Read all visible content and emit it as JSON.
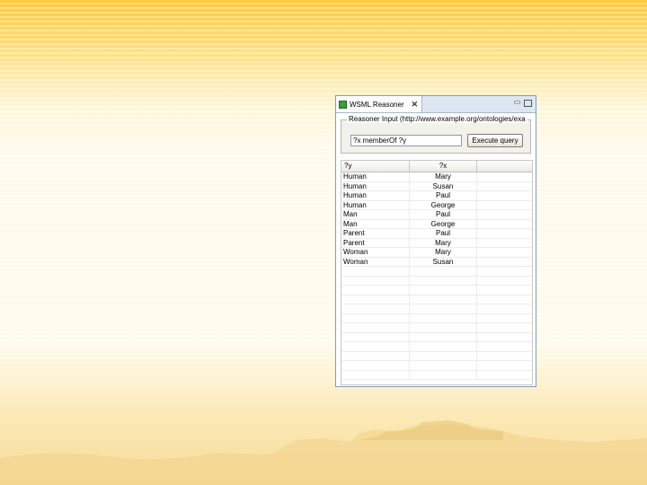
{
  "view": {
    "tab_title": "WSML Reasoner",
    "tab_close": "✕",
    "minimize": "▭",
    "maximize": "",
    "group_label": "Reasoner Input (http://www.example.org/ontologies/exa",
    "query_value": "?x memberOf ?y",
    "execute_label": "Execute query"
  },
  "table": {
    "columns": [
      "?y",
      "?x",
      ""
    ],
    "rows": [
      [
        "Human",
        "Mary"
      ],
      [
        "Human",
        "Susan"
      ],
      [
        "Human",
        "Paul"
      ],
      [
        "Human",
        "George"
      ],
      [
        "Man",
        "Paul"
      ],
      [
        "Man",
        "George"
      ],
      [
        "Parent",
        "Paul"
      ],
      [
        "Parent",
        "Mary"
      ],
      [
        "Woman",
        "Mary"
      ],
      [
        "Woman",
        "Susan"
      ]
    ],
    "empty_rows": 12
  },
  "colors": {
    "accent": "#ffc93a",
    "background": "#fffbee",
    "tab_icon": "#3c9a3c"
  }
}
